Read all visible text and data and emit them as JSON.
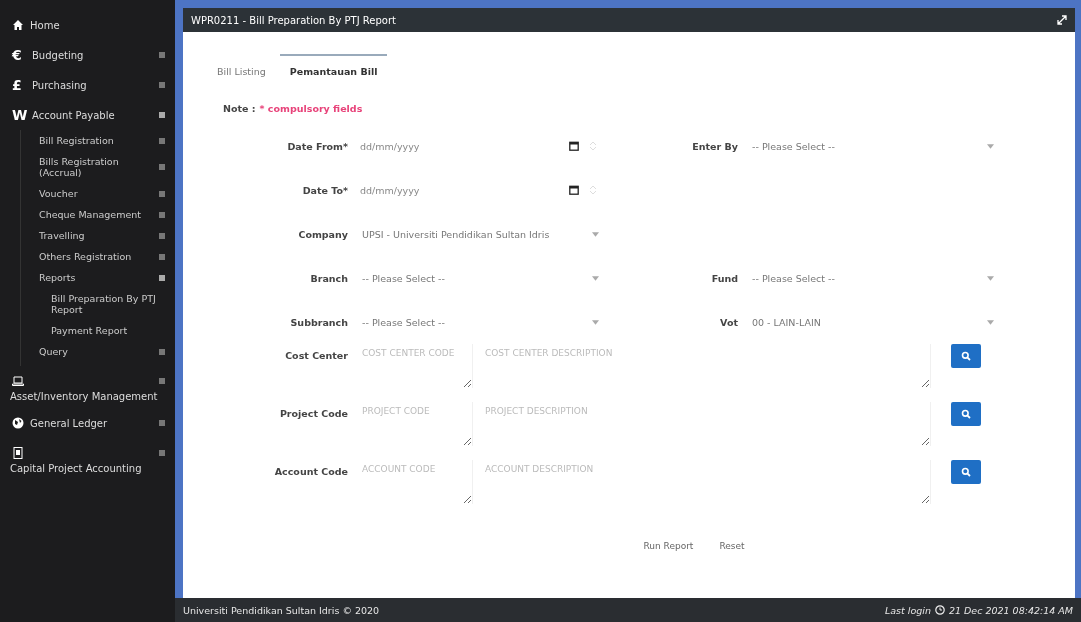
{
  "sidebar": {
    "items": [
      {
        "kind": "home",
        "label": "Home"
      },
      {
        "kind": "glyph",
        "glyph": "€",
        "label": "Budgeting",
        "expanded": false
      },
      {
        "kind": "glyph",
        "glyph": "£",
        "label": "Purchasing",
        "expanded": false
      },
      {
        "kind": "glyph",
        "glyph": "W",
        "label": "Account Payable",
        "expanded": true,
        "children": [
          {
            "label": "Bill Registration",
            "expanded": false
          },
          {
            "label": "Bills Registration (Accrual)",
            "expanded": false
          },
          {
            "label": "Voucher",
            "expanded": false
          },
          {
            "label": "Cheque Management",
            "expanded": false
          },
          {
            "label": "Travelling",
            "expanded": false
          },
          {
            "label": "Others Registration",
            "expanded": false
          },
          {
            "label": "Reports",
            "expanded": true,
            "children": [
              {
                "label": "Bill Preparation By PTJ Report"
              },
              {
                "label": "Payment Report"
              }
            ]
          },
          {
            "label": "Query",
            "expanded": false
          }
        ]
      },
      {
        "kind": "laptop",
        "label": "Asset/Inventory Management",
        "expanded": false
      },
      {
        "kind": "globe",
        "label": "General Ledger",
        "expanded": false
      },
      {
        "kind": "device",
        "label": "Capital Project Accounting",
        "expanded": false
      }
    ]
  },
  "panel": {
    "title": "WPR0211 - Bill Preparation By PTJ Report"
  },
  "tabs": [
    {
      "label": "Bill Listing",
      "selected": false
    },
    {
      "label": "Pemantauan Bill",
      "selected": true
    }
  ],
  "note": {
    "label": "Note :",
    "text": "* compulsory fields"
  },
  "form": {
    "rows": [
      {
        "left": {
          "kind": "date",
          "label": "Date From*",
          "placeholder": "dd/mm/yyyy"
        },
        "right": {
          "kind": "select",
          "label": "Enter By",
          "value": "-- Please Select --"
        }
      },
      {
        "left": {
          "kind": "date",
          "label": "Date To*",
          "placeholder": "dd/mm/yyyy"
        }
      },
      {
        "left": {
          "kind": "select",
          "label": "Company",
          "value": "UPSI - Universiti Pendidikan Sultan Idris"
        }
      },
      {
        "left": {
          "kind": "select",
          "label": "Branch",
          "value": "-- Please Select --"
        },
        "right": {
          "kind": "select",
          "label": "Fund",
          "value": "-- Please Select --"
        }
      },
      {
        "left": {
          "kind": "select",
          "label": "Subbranch",
          "value": "-- Please Select --"
        },
        "right": {
          "kind": "select",
          "label": "Vot",
          "value": "00 - LAIN-LAIN"
        }
      },
      {
        "left": {
          "kind": "lookup",
          "label": "Cost Center",
          "code_placeholder": "COST CENTER CODE",
          "desc_placeholder": "COST CENTER DESCRIPTION"
        }
      },
      {
        "left": {
          "kind": "lookup",
          "label": "Project Code",
          "code_placeholder": "PROJECT CODE",
          "desc_placeholder": "PROJECT DESCRIPTION"
        }
      },
      {
        "left": {
          "kind": "lookup",
          "label": "Account Code",
          "code_placeholder": "ACCOUNT CODE",
          "desc_placeholder": "ACCOUNT DESCRIPTION"
        }
      }
    ]
  },
  "actions": [
    "Run Report",
    "Reset"
  ],
  "footer": {
    "copyright": "Universiti Pendidikan Sultan Idris © 2020",
    "last_login_label": "Last login",
    "timestamp": "21 Dec 2021 08:42:14 AM"
  }
}
